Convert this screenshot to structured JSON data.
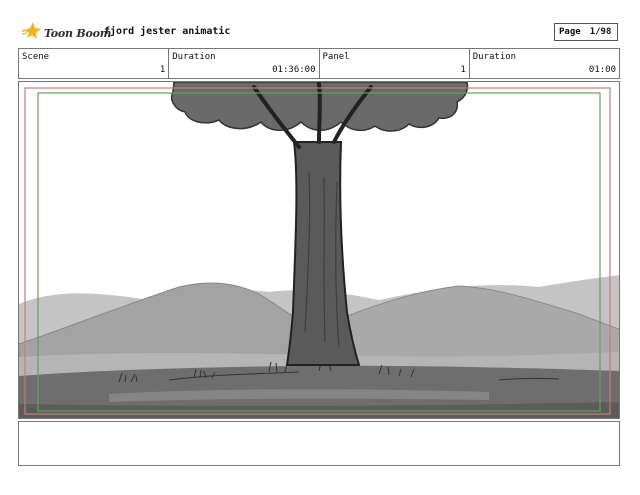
{
  "header": {
    "logo_text": "Toon Boom",
    "project_title": "fjord jester animatic",
    "page_label": "Page",
    "page_value": "1/98"
  },
  "info": {
    "scene_label": "Scene",
    "scene_value": "1",
    "scene_duration_label": "Duration",
    "scene_duration_value": "01:36:00",
    "panel_label": "Panel",
    "panel_value": "1",
    "panel_duration_label": "Duration",
    "panel_duration_value": "01:00"
  },
  "colors": {
    "logo_accent": "#f2b320",
    "safe_frame_red": "#c97a7a",
    "camera_frame_green": "#5fa35f"
  },
  "icons": {
    "logo": "toon-boom-star-icon"
  },
  "caption": {
    "text": ""
  }
}
